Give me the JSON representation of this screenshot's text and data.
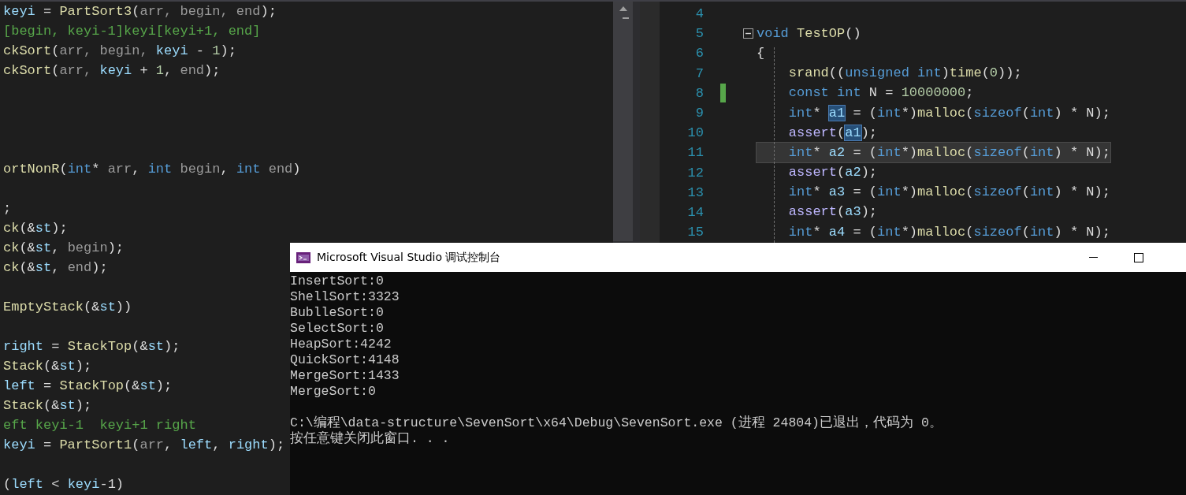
{
  "left_editor": {
    "lines": [
      {
        "kind": "code",
        "tokens": [
          {
            "text": "keyi",
            "kind": "var"
          },
          {
            "text": " = ",
            "kind": "plain"
          },
          {
            "text": "PartSort3",
            "kind": "func"
          },
          {
            "text": "(",
            "kind": "plain"
          },
          {
            "text": "arr, begin, end",
            "kind": "param"
          },
          {
            "text": ");",
            "kind": "plain"
          }
        ]
      },
      {
        "kind": "code",
        "tokens": [
          {
            "text": "[begin, keyi-1]keyi[keyi+1, end]",
            "kind": "comment"
          }
        ]
      },
      {
        "kind": "code",
        "tokens": [
          {
            "text": "ckSort",
            "kind": "func"
          },
          {
            "text": "(",
            "kind": "plain"
          },
          {
            "text": "arr, begin, ",
            "kind": "param"
          },
          {
            "text": "keyi",
            "kind": "var"
          },
          {
            "text": " - ",
            "kind": "plain"
          },
          {
            "text": "1",
            "kind": "num"
          },
          {
            "text": ");",
            "kind": "plain"
          }
        ]
      },
      {
        "kind": "code",
        "tokens": [
          {
            "text": "ckSort",
            "kind": "func"
          },
          {
            "text": "(",
            "kind": "plain"
          },
          {
            "text": "arr, ",
            "kind": "param"
          },
          {
            "text": "keyi",
            "kind": "var"
          },
          {
            "text": " + ",
            "kind": "plain"
          },
          {
            "text": "1",
            "kind": "num"
          },
          {
            "text": ", ",
            "kind": "plain"
          },
          {
            "text": "end",
            "kind": "param"
          },
          {
            "text": ");",
            "kind": "plain"
          }
        ]
      },
      {
        "kind": "blank"
      },
      {
        "kind": "blank"
      },
      {
        "kind": "blank"
      },
      {
        "kind": "blank"
      },
      {
        "kind": "code",
        "tokens": [
          {
            "text": "ortNonR",
            "kind": "func"
          },
          {
            "text": "(",
            "kind": "plain"
          },
          {
            "text": "int",
            "kind": "kw"
          },
          {
            "text": "* ",
            "kind": "plain"
          },
          {
            "text": "arr",
            "kind": "param"
          },
          {
            "text": ", ",
            "kind": "plain"
          },
          {
            "text": "int",
            "kind": "kw"
          },
          {
            "text": " begin",
            "kind": "param"
          },
          {
            "text": ", ",
            "kind": "plain"
          },
          {
            "text": "int",
            "kind": "kw"
          },
          {
            "text": " end",
            "kind": "param"
          },
          {
            "text": ")",
            "kind": "plain"
          }
        ]
      },
      {
        "kind": "blank"
      },
      {
        "kind": "code",
        "tokens": [
          {
            "text": ";",
            "kind": "plain"
          }
        ]
      },
      {
        "kind": "code",
        "tokens": [
          {
            "text": "ck",
            "kind": "func"
          },
          {
            "text": "(&",
            "kind": "plain"
          },
          {
            "text": "st",
            "kind": "var"
          },
          {
            "text": ");",
            "kind": "plain"
          }
        ]
      },
      {
        "kind": "code",
        "tokens": [
          {
            "text": "ck",
            "kind": "func"
          },
          {
            "text": "(&",
            "kind": "plain"
          },
          {
            "text": "st",
            "kind": "var"
          },
          {
            "text": ", ",
            "kind": "plain"
          },
          {
            "text": "begin",
            "kind": "param"
          },
          {
            "text": ");",
            "kind": "plain"
          }
        ]
      },
      {
        "kind": "code",
        "tokens": [
          {
            "text": "ck",
            "kind": "func"
          },
          {
            "text": "(&",
            "kind": "plain"
          },
          {
            "text": "st",
            "kind": "var"
          },
          {
            "text": ", ",
            "kind": "plain"
          },
          {
            "text": "end",
            "kind": "param"
          },
          {
            "text": ");",
            "kind": "plain"
          }
        ]
      },
      {
        "kind": "blank"
      },
      {
        "kind": "code",
        "tokens": [
          {
            "text": "EmptyStack",
            "kind": "func"
          },
          {
            "text": "(&",
            "kind": "plain"
          },
          {
            "text": "st",
            "kind": "var"
          },
          {
            "text": "))",
            "kind": "plain"
          }
        ]
      },
      {
        "kind": "blank"
      },
      {
        "kind": "code",
        "tokens": [
          {
            "text": "right",
            "kind": "var"
          },
          {
            "text": " = ",
            "kind": "plain"
          },
          {
            "text": "StackTop",
            "kind": "func"
          },
          {
            "text": "(&",
            "kind": "plain"
          },
          {
            "text": "st",
            "kind": "var"
          },
          {
            "text": ");",
            "kind": "plain"
          }
        ]
      },
      {
        "kind": "code",
        "tokens": [
          {
            "text": "Stack",
            "kind": "func"
          },
          {
            "text": "(&",
            "kind": "plain"
          },
          {
            "text": "st",
            "kind": "var"
          },
          {
            "text": ");",
            "kind": "plain"
          }
        ]
      },
      {
        "kind": "code",
        "tokens": [
          {
            "text": "left",
            "kind": "var"
          },
          {
            "text": " = ",
            "kind": "plain"
          },
          {
            "text": "StackTop",
            "kind": "func"
          },
          {
            "text": "(&",
            "kind": "plain"
          },
          {
            "text": "st",
            "kind": "var"
          },
          {
            "text": ");",
            "kind": "plain"
          }
        ]
      },
      {
        "kind": "code",
        "tokens": [
          {
            "text": "Stack",
            "kind": "func"
          },
          {
            "text": "(&",
            "kind": "plain"
          },
          {
            "text": "st",
            "kind": "var"
          },
          {
            "text": ");",
            "kind": "plain"
          }
        ]
      },
      {
        "kind": "code",
        "tokens": [
          {
            "text": "eft keyi-1  keyi+1 right",
            "kind": "comment"
          }
        ]
      },
      {
        "kind": "code",
        "tokens": [
          {
            "text": "keyi",
            "kind": "var"
          },
          {
            "text": " = ",
            "kind": "plain"
          },
          {
            "text": "PartSort1",
            "kind": "func"
          },
          {
            "text": "(",
            "kind": "plain"
          },
          {
            "text": "arr",
            "kind": "param"
          },
          {
            "text": ", ",
            "kind": "plain"
          },
          {
            "text": "left",
            "kind": "var"
          },
          {
            "text": ", ",
            "kind": "plain"
          },
          {
            "text": "right",
            "kind": "var"
          },
          {
            "text": ");",
            "kind": "plain"
          }
        ]
      },
      {
        "kind": "blank"
      },
      {
        "kind": "code",
        "tokens": [
          {
            "text": "(",
            "kind": "plain"
          },
          {
            "text": "left",
            "kind": "var"
          },
          {
            "text": " < ",
            "kind": "plain"
          },
          {
            "text": "keyi",
            "kind": "var"
          },
          {
            "text": "-1)",
            "kind": "plain"
          }
        ]
      }
    ]
  },
  "right_editor": {
    "lines": [
      {
        "number": "4",
        "foldable": false,
        "changed": false,
        "current": false
      },
      {
        "number": "5",
        "foldable": true,
        "changed": false,
        "current": false,
        "tokens": [
          {
            "text": "void",
            "kind": "kw"
          },
          {
            "text": " TestOP",
            "kind": "func"
          },
          {
            "text": "()",
            "kind": "plain"
          }
        ]
      },
      {
        "number": "6",
        "foldable": false,
        "changed": false,
        "current": false,
        "tokens": [
          {
            "text": "{",
            "kind": "plain"
          }
        ],
        "children": [
          {
            "number": "7",
            "foldable": false,
            "changed": false,
            "current": false,
            "tokens": [
              {
                "text": "srand",
                "kind": "func"
              },
              {
                "text": "((",
                "kind": "plain"
              },
              {
                "text": "unsigned int",
                "kind": "kw"
              },
              {
                "text": ")",
                "kind": "plain"
              },
              {
                "text": "time",
                "kind": "func"
              },
              {
                "text": "(",
                "kind": "plain"
              },
              {
                "text": "0",
                "kind": "num"
              },
              {
                "text": "));",
                "kind": "plain"
              }
            ]
          },
          {
            "number": "8",
            "foldable": false,
            "changed": true,
            "current": false,
            "tokens": [
              {
                "text": "const int",
                "kind": "kw"
              },
              {
                "text": " N = ",
                "kind": "plain"
              },
              {
                "text": "10000000",
                "kind": "num"
              },
              {
                "text": ";",
                "kind": "plain"
              }
            ]
          },
          {
            "number": "9",
            "foldable": false,
            "changed": false,
            "current": false,
            "tokens": [
              {
                "text": "int",
                "kind": "kw"
              },
              {
                "text": "* ",
                "kind": "plain"
              },
              {
                "text": "a1",
                "kind": "var_marked"
              },
              {
                "text": " = (",
                "kind": "plain"
              },
              {
                "text": "int",
                "kind": "kw"
              },
              {
                "text": "*)",
                "kind": "plain"
              },
              {
                "text": "malloc",
                "kind": "func"
              },
              {
                "text": "(",
                "kind": "plain"
              },
              {
                "text": "sizeof",
                "kind": "kw"
              },
              {
                "text": "(",
                "kind": "plain"
              },
              {
                "text": "int",
                "kind": "kw"
              },
              {
                "text": ") * N);",
                "kind": "plain"
              }
            ]
          },
          {
            "number": "10",
            "foldable": false,
            "changed": false,
            "current": false,
            "tokens": [
              {
                "text": "assert",
                "kind": "macro"
              },
              {
                "text": "(",
                "kind": "plain"
              },
              {
                "text": "a1",
                "kind": "var_marked"
              },
              {
                "text": ");",
                "kind": "plain"
              }
            ]
          },
          {
            "number": "11",
            "foldable": false,
            "changed": false,
            "current": true,
            "tokens": [
              {
                "text": "int",
                "kind": "kw"
              },
              {
                "text": "* ",
                "kind": "plain"
              },
              {
                "text": "a2",
                "kind": "var"
              },
              {
                "text": " = (",
                "kind": "plain"
              },
              {
                "text": "int",
                "kind": "kw"
              },
              {
                "text": "*)",
                "kind": "plain"
              },
              {
                "text": "malloc",
                "kind": "func"
              },
              {
                "text": "(",
                "kind": "plain"
              },
              {
                "text": "sizeof",
                "kind": "kw"
              },
              {
                "text": "(",
                "kind": "plain"
              },
              {
                "text": "int",
                "kind": "kw"
              },
              {
                "text": ") * N);",
                "kind": "plain"
              }
            ]
          },
          {
            "number": "12",
            "foldable": false,
            "changed": false,
            "current": false,
            "tokens": [
              {
                "text": "assert",
                "kind": "macro"
              },
              {
                "text": "(",
                "kind": "plain"
              },
              {
                "text": "a2",
                "kind": "var"
              },
              {
                "text": ");",
                "kind": "plain"
              }
            ]
          },
          {
            "number": "13",
            "foldable": false,
            "changed": false,
            "current": false,
            "tokens": [
              {
                "text": "int",
                "kind": "kw"
              },
              {
                "text": "* ",
                "kind": "plain"
              },
              {
                "text": "a3",
                "kind": "var"
              },
              {
                "text": " = (",
                "kind": "plain"
              },
              {
                "text": "int",
                "kind": "kw"
              },
              {
                "text": "*)",
                "kind": "plain"
              },
              {
                "text": "malloc",
                "kind": "func"
              },
              {
                "text": "(",
                "kind": "plain"
              },
              {
                "text": "sizeof",
                "kind": "kw"
              },
              {
                "text": "(",
                "kind": "plain"
              },
              {
                "text": "int",
                "kind": "kw"
              },
              {
                "text": ") * N);",
                "kind": "plain"
              }
            ]
          },
          {
            "number": "14",
            "foldable": false,
            "changed": false,
            "current": false,
            "tokens": [
              {
                "text": "assert",
                "kind": "macro"
              },
              {
                "text": "(",
                "kind": "plain"
              },
              {
                "text": "a3",
                "kind": "var"
              },
              {
                "text": ");",
                "kind": "plain"
              }
            ]
          },
          {
            "number": "15",
            "foldable": false,
            "changed": false,
            "current": false,
            "tokens": [
              {
                "text": "int",
                "kind": "kw"
              },
              {
                "text": "* ",
                "kind": "plain"
              },
              {
                "text": "a4",
                "kind": "var"
              },
              {
                "text": " = (",
                "kind": "plain"
              },
              {
                "text": "int",
                "kind": "kw"
              },
              {
                "text": "*)",
                "kind": "plain"
              },
              {
                "text": "malloc",
                "kind": "func"
              },
              {
                "text": "(",
                "kind": "plain"
              },
              {
                "text": "sizeof",
                "kind": "kw"
              },
              {
                "text": "(",
                "kind": "plain"
              },
              {
                "text": "int",
                "kind": "kw"
              },
              {
                "text": ") * N);",
                "kind": "plain"
              }
            ]
          }
        ]
      }
    ]
  },
  "console": {
    "title": "Microsoft Visual Studio 调试控制台",
    "output_lines": [
      "InsertSort:0",
      "ShellSort:3323",
      "BublleSort:0",
      "SelectSort:0",
      "HeapSort:4242",
      "QuickSort:4148",
      "MergeSort:1433",
      "MergeSort:0"
    ],
    "exit_lines": [
      "C:\\编程\\data-structure\\SevenSort\\x64\\Debug\\SevenSort.exe (进程 24804)已退出，代码为 0。",
      "按任意键关闭此窗口. . ."
    ]
  }
}
